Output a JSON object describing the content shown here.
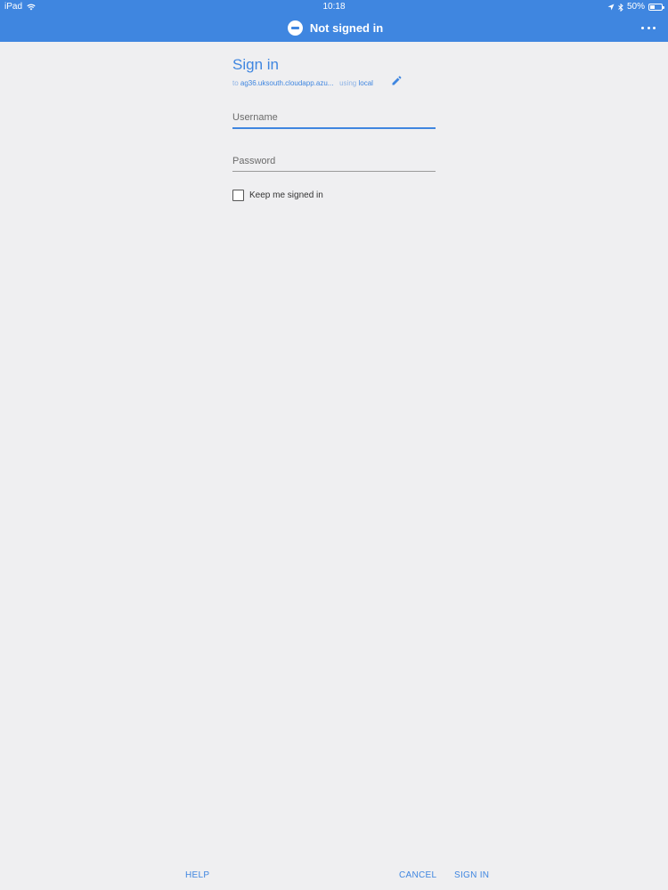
{
  "status_bar": {
    "device": "iPad",
    "time": "10:18",
    "battery": "50%",
    "battery_level": 0.5,
    "icons": [
      "wifi-icon",
      "location-arrow-icon",
      "bluetooth-icon",
      "battery-icon"
    ]
  },
  "app_bar": {
    "title": "Not signed in",
    "status_icon": "no-entry-icon",
    "menu_icon": "more-icon"
  },
  "sign_in": {
    "title": "Sign in",
    "to_prefix": "to",
    "server": "ag36.uksouth.cloudapp.azu...",
    "using_prefix": "using",
    "provider": "local",
    "edit_icon": "pencil-icon",
    "username_placeholder": "Username",
    "password_placeholder": "Password",
    "keep_signed_in_label": "Keep me signed in",
    "keep_signed_in_checked": false
  },
  "footer": {
    "help_label": "HELP",
    "cancel_label": "CANCEL",
    "sign_in_label": "SIGN IN"
  },
  "colors": {
    "accent": "#3f86e0",
    "background": "#efeff1"
  }
}
